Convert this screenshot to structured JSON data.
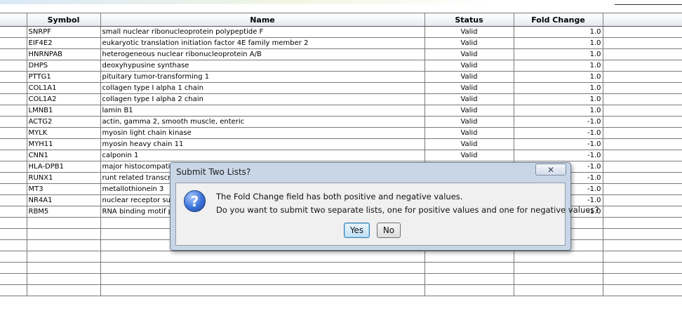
{
  "table": {
    "headers": {
      "symbol": "Symbol",
      "name": "Name",
      "status": "Status",
      "fold": "Fold Change"
    },
    "rows": [
      {
        "symbol": "SNRPF",
        "name": "small nuclear ribonucleoprotein polypeptide F",
        "status": "Valid",
        "fold": "1.0"
      },
      {
        "symbol": "EIF4E2",
        "name": "eukaryotic translation initiation factor 4E family member 2",
        "status": "Valid",
        "fold": "1.0"
      },
      {
        "symbol": "HNRNPAB",
        "name": "heterogeneous nuclear ribonucleoprotein A/B",
        "status": "Valid",
        "fold": "1.0"
      },
      {
        "symbol": "DHPS",
        "name": "deoxyhypusine synthase",
        "status": "Valid",
        "fold": "1.0"
      },
      {
        "symbol": "PTTG1",
        "name": "pituitary tumor-transforming 1",
        "status": "Valid",
        "fold": "1.0"
      },
      {
        "symbol": "COL1A1",
        "name": "collagen type I alpha 1 chain",
        "status": "Valid",
        "fold": "1.0"
      },
      {
        "symbol": "COL1A2",
        "name": "collagen type I alpha 2 chain",
        "status": "Valid",
        "fold": "1.0"
      },
      {
        "symbol": "LMNB1",
        "name": "lamin B1",
        "status": "Valid",
        "fold": "1.0"
      },
      {
        "symbol": "ACTG2",
        "name": "actin, gamma 2, smooth muscle, enteric",
        "status": "Valid",
        "fold": "-1.0"
      },
      {
        "symbol": "MYLK",
        "name": "myosin light chain kinase",
        "status": "Valid",
        "fold": "-1.0"
      },
      {
        "symbol": "MYH11",
        "name": "myosin heavy chain 11",
        "status": "Valid",
        "fold": "-1.0"
      },
      {
        "symbol": "CNN1",
        "name": "calponin 1",
        "status": "Valid",
        "fold": "-1.0"
      },
      {
        "symbol": "HLA-DPB1",
        "name": "major histocompatib",
        "status": "",
        "fold": "-1.0"
      },
      {
        "symbol": "RUNX1",
        "name": "runt related transcri",
        "status": "",
        "fold": "-1.0"
      },
      {
        "symbol": "MT3",
        "name": "metallothionein 3",
        "status": "",
        "fold": "-1.0"
      },
      {
        "symbol": "NR4A1",
        "name": "nuclear receptor sub",
        "status": "",
        "fold": "-1.0"
      },
      {
        "symbol": "RBM5",
        "name": "RNA binding motif pr",
        "status": "",
        "fold": "-1.0"
      },
      {
        "symbol": "",
        "name": "",
        "status": "",
        "fold": ""
      },
      {
        "symbol": "",
        "name": "",
        "status": "",
        "fold": ""
      },
      {
        "symbol": "",
        "name": "",
        "status": "",
        "fold": ""
      },
      {
        "symbol": "",
        "name": "",
        "status": "",
        "fold": ""
      },
      {
        "symbol": "",
        "name": "",
        "status": "",
        "fold": ""
      },
      {
        "symbol": "",
        "name": "",
        "status": "",
        "fold": ""
      },
      {
        "symbol": "",
        "name": "",
        "status": "",
        "fold": ""
      }
    ]
  },
  "dialog": {
    "title": "Submit Two Lists?",
    "close_glyph": "✕",
    "icon_glyph": "?",
    "message_line1": "The Fold Change field has both positive and negative values.",
    "message_line2": "Do you want to submit two separate lists, one for positive values and one for negative values?",
    "yes_label": "Yes",
    "no_label": "No"
  }
}
